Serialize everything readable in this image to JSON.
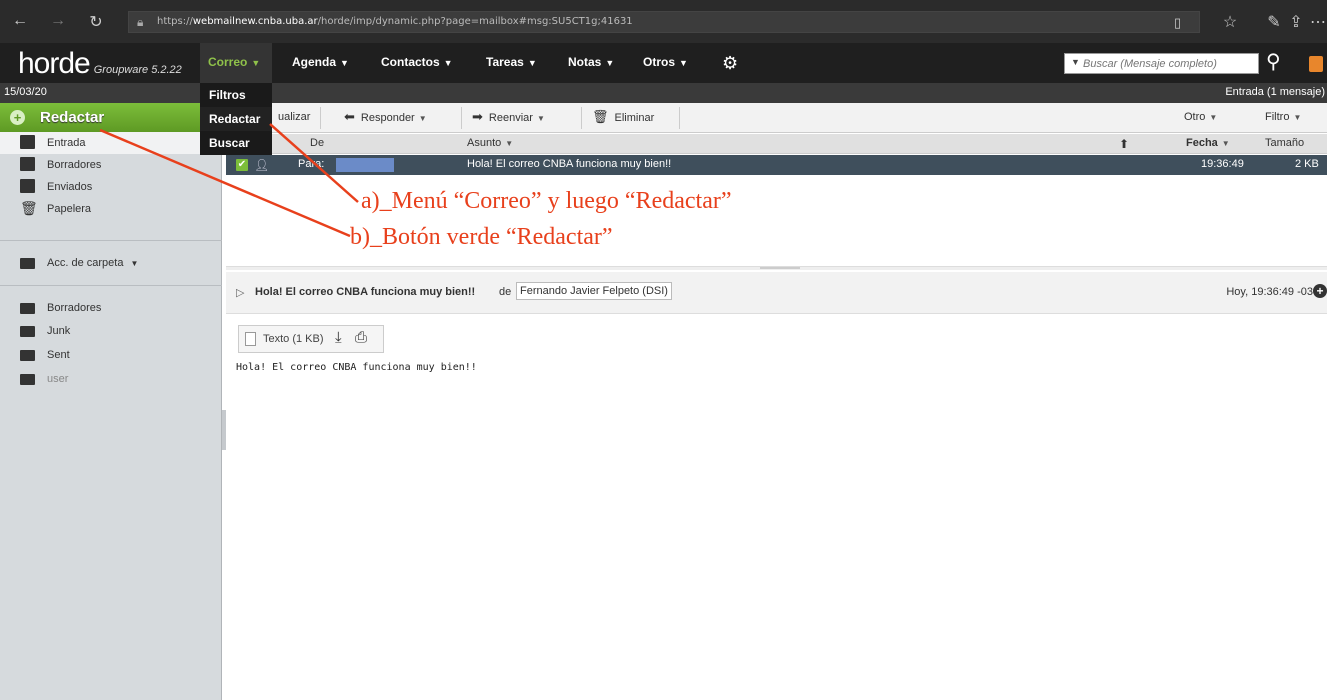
{
  "browser": {
    "url_prefix": "https://",
    "url_host": "webmailnew.cnba.uba.ar",
    "url_path": "/horde/imp/dynamic.php?page=mailbox#msg:SU5CT1g;41631"
  },
  "app": {
    "logo": "horde",
    "logo_sub": "Groupware 5.2.22"
  },
  "nav": {
    "items": [
      "Correo",
      "Agenda",
      "Contactos",
      "Tareas",
      "Notas",
      "Otros"
    ],
    "search_placeholder": "Buscar (Mensaje completo)"
  },
  "correo_menu": [
    "Filtros",
    "Redactar",
    "Buscar"
  ],
  "subbar": {
    "date": "15/03/20",
    "mailbox": "Entrada (1 mensaje)"
  },
  "sidebar": {
    "compose": "Redactar",
    "folders": [
      "Entrada",
      "Borradores",
      "Enviados",
      "Papelera"
    ],
    "folder_actions": "Acc. de carpeta",
    "other_folders": [
      "Borradores",
      "Junk",
      "Sent",
      "user"
    ]
  },
  "toolbar": {
    "refresh": "ualizar",
    "reply": "Responder",
    "forward": "Reenviar",
    "delete": "Eliminar",
    "other": "Otro",
    "filter": "Filtro"
  },
  "list": {
    "headers": {
      "from": "De",
      "subject": "Asunto",
      "date": "Fecha",
      "size": "Tamaño"
    },
    "rows": [
      {
        "from": "Para:",
        "subject": "Hola! El correo CNBA funciona muy bien!!",
        "date": "19:36:49",
        "size": "2 KB"
      }
    ]
  },
  "preview": {
    "subject": "Hola! El correo CNBA funciona muy bien!!",
    "from_word": "de",
    "from": "Fernando Javier Felpeto (DSI)",
    "date": "Hoy, 19:36:49 -03",
    "attachment": "Texto (1 KB)",
    "body": "Hola! El correo CNBA funciona muy bien!!"
  },
  "annotations": {
    "a": "a)_Menú “Correo” y luego “Redactar”",
    "b": "b)_Botón verde “Redactar”",
    "color": "#e8401c"
  }
}
